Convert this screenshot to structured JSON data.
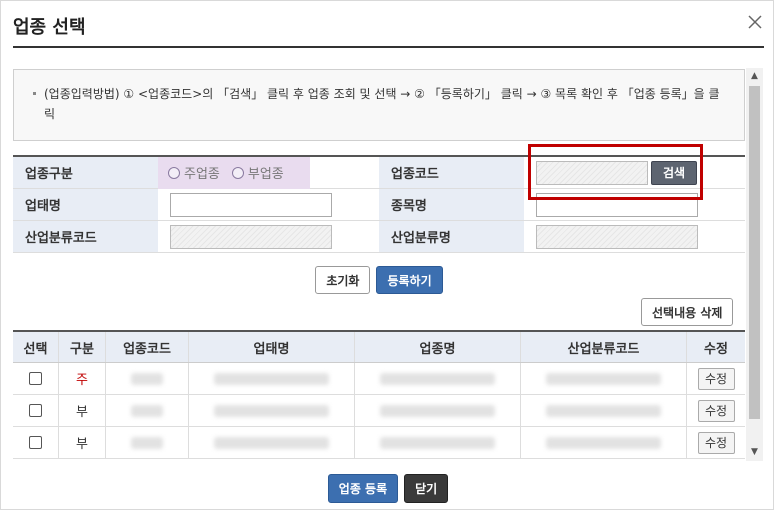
{
  "dialog": {
    "title": "업종 선택",
    "close_icon": "close-icon"
  },
  "notice": {
    "text": "(업종입력방법) ① <업종코드>의 「검색」 클릭 후 업종 조회 및 선택 → ② 「등록하기」 클릭 → ③ 목록 확인 후 「업종 등록」을 클릭"
  },
  "form": {
    "kind_label": "업종구분",
    "radio_main": "주업종",
    "radio_sub": "부업종",
    "code_label": "업종코드",
    "search_button": "검색",
    "type_name_label": "업태명",
    "item_name_label": "종목명",
    "industry_code_label": "산업분류코드",
    "industry_name_label": "산업분류명"
  },
  "actions": {
    "reset": "초기화",
    "register": "등록하기",
    "delete_selected": "선택내용 삭제"
  },
  "table": {
    "headers": [
      "선택",
      "구분",
      "업종코드",
      "업태명",
      "업종명",
      "산업분류코드",
      "수정"
    ],
    "rows": [
      {
        "kind": "주",
        "edit": "수정"
      },
      {
        "kind": "부",
        "edit": "수정"
      },
      {
        "kind": "부",
        "edit": "수정"
      }
    ]
  },
  "footer": {
    "register_industry": "업종 등록",
    "close": "닫기"
  },
  "colors": {
    "highlight": "#c00000",
    "primary": "#3c6fb0",
    "header_bg": "#e8edf5",
    "radio_bg": "#e9dcef"
  }
}
